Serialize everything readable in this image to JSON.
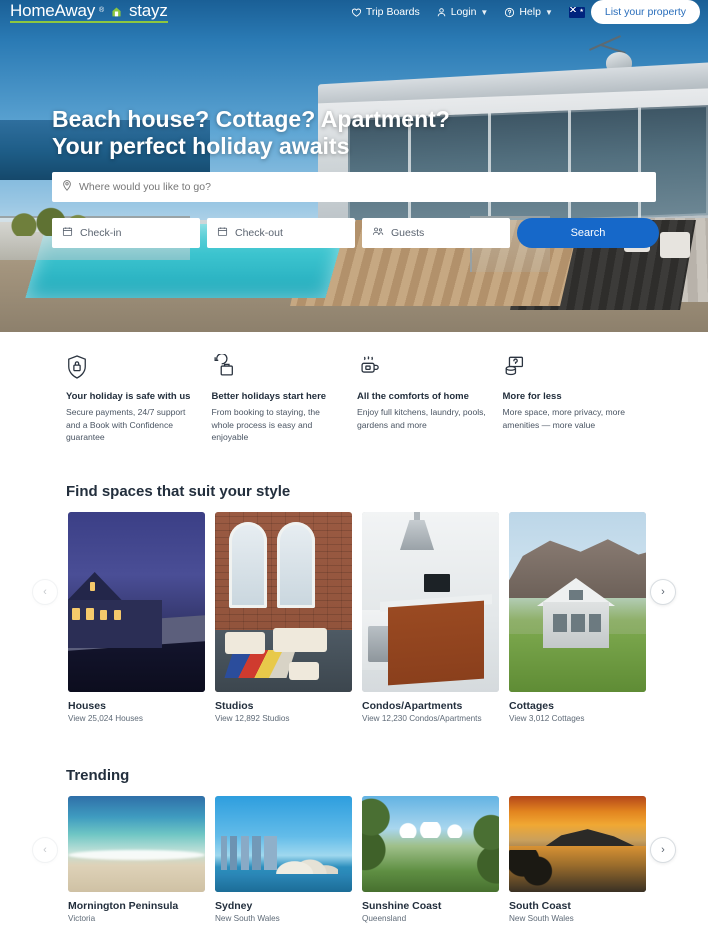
{
  "header": {
    "logo_primary": "HomeAway",
    "logo_sup": "®",
    "logo_secondary": "stayz",
    "nav": [
      {
        "label": "Trip Boards",
        "icon": "heart-icon",
        "has_chevron": false
      },
      {
        "label": "Login",
        "icon": "person-icon",
        "has_chevron": true
      },
      {
        "label": "Help",
        "icon": "question-circle-icon",
        "has_chevron": true
      }
    ],
    "locale_flag": "australia-flag-icon",
    "cta_label": "List your property"
  },
  "hero": {
    "headline_line1": "Beach house? Cottage? Apartment?",
    "headline_line2": "Your perfect holiday awaits",
    "search": {
      "destination_placeholder": "Where would you like to go?",
      "destination_value": "",
      "destination_icon": "location-pin-icon",
      "checkin_label": "Check-in",
      "checkin_icon": "calendar-icon",
      "checkout_label": "Check-out",
      "checkout_icon": "calendar-icon",
      "guests_label": "Guests",
      "guests_icon": "guests-icon",
      "search_button": "Search"
    }
  },
  "value_props": [
    {
      "icon": "shield-lock-icon",
      "title": "Your holiday is safe with us",
      "body": "Secure payments, 24/7 support and a Book with Confidence guarantee"
    },
    {
      "icon": "suitcase-clock-icon",
      "title": "Better holidays start here",
      "body": "From booking to staying, the whole process is easy and enjoyable"
    },
    {
      "icon": "coffee-cup-icon",
      "title": "All the comforts of home",
      "body": "Enjoy full kitchens, laundry, pools, gardens and more"
    },
    {
      "icon": "coins-value-icon",
      "title": "More for less",
      "body": "More space, more privacy, more amenities — more value"
    }
  ],
  "spaces": {
    "title": "Find spaces that suit your style",
    "prev_icon": "chevron-left-icon",
    "next_icon": "chevron-right-icon",
    "cards": [
      {
        "title": "Houses",
        "subtitle": "View 25,024 Houses",
        "art": "a-house"
      },
      {
        "title": "Studios",
        "subtitle": "View 12,892 Studios",
        "art": "a-studio"
      },
      {
        "title": "Condos/Apartments",
        "subtitle": "View 12,230 Condos/Apartments",
        "art": "a-condo"
      },
      {
        "title": "Cottages",
        "subtitle": "View 3,012 Cottages",
        "art": "a-cottage"
      }
    ]
  },
  "trending": {
    "title": "Trending",
    "prev_icon": "chevron-left-icon",
    "next_icon": "chevron-right-icon",
    "cards": [
      {
        "title": "Mornington Peninsula",
        "subtitle": "Victoria",
        "art": "a-beach"
      },
      {
        "title": "Sydney",
        "subtitle": "New South Wales",
        "art": "a-sydney"
      },
      {
        "title": "Sunshine Coast",
        "subtitle": "Queensland",
        "art": "a-sunshine"
      },
      {
        "title": "South Coast",
        "subtitle": "New South Wales",
        "art": "a-south"
      }
    ]
  },
  "colors": {
    "primary_blue": "#1668c9",
    "logo_green": "#8dc63f",
    "text_dark": "#232f3d",
    "text_muted": "#5e6a77"
  }
}
